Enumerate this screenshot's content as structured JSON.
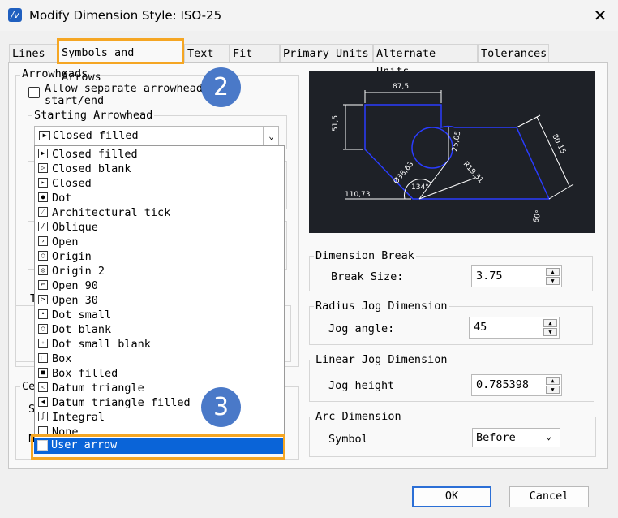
{
  "window": {
    "title": "Modify Dimension Style: ISO-25",
    "close_glyph": "✕"
  },
  "tabs": [
    {
      "label": "Lines"
    },
    {
      "label": "Symbols and Arrows"
    },
    {
      "label": "Text"
    },
    {
      "label": "Fit"
    },
    {
      "label": "Primary Units"
    },
    {
      "label": "Alternate Units"
    },
    {
      "label": "Tolerances"
    }
  ],
  "arrowheads": {
    "group_label": "Arrowheads",
    "allow_separate_line1": "Allow separate arrowhead",
    "allow_separate_line2": "start/end",
    "starting_label": "Starting Arrowhead",
    "selected": "Closed filled",
    "options": [
      {
        "label": "Closed filled",
        "icon": "closed-filled-icon",
        "glyph": "▶"
      },
      {
        "label": "Closed blank",
        "icon": "closed-blank-icon",
        "glyph": "▷"
      },
      {
        "label": "Closed",
        "icon": "closed-icon",
        "glyph": "▸"
      },
      {
        "label": "Dot",
        "icon": "dot-icon",
        "glyph": "●"
      },
      {
        "label": "Architectural tick",
        "icon": "architectural-tick-icon",
        "glyph": "⁄"
      },
      {
        "label": "Oblique",
        "icon": "oblique-icon",
        "glyph": "/"
      },
      {
        "label": "Open",
        "icon": "open-icon",
        "glyph": "›"
      },
      {
        "label": "Origin",
        "icon": "origin-icon",
        "glyph": "○"
      },
      {
        "label": "Origin 2",
        "icon": "origin-2-icon",
        "glyph": "◎"
      },
      {
        "label": "Open 90",
        "icon": "open-90-icon",
        "glyph": "⌐"
      },
      {
        "label": "Open 30",
        "icon": "open-30-icon",
        "glyph": ">"
      },
      {
        "label": "Dot small",
        "icon": "dot-small-icon",
        "glyph": "•"
      },
      {
        "label": "Dot blank",
        "icon": "dot-blank-icon",
        "glyph": "○"
      },
      {
        "label": "Dot small blank",
        "icon": "dot-small-blank-icon",
        "glyph": "◦"
      },
      {
        "label": "Box",
        "icon": "box-icon",
        "glyph": "□"
      },
      {
        "label": "Box filled",
        "icon": "box-filled-icon",
        "glyph": "■"
      },
      {
        "label": "Datum triangle",
        "icon": "datum-triangle-icon",
        "glyph": "◁"
      },
      {
        "label": "Datum triangle filled",
        "icon": "datum-triangle-filled-icon",
        "glyph": "◀"
      },
      {
        "label": "Integral",
        "icon": "integral-icon",
        "glyph": "∫"
      },
      {
        "label": "None",
        "icon": "none-icon",
        "glyph": ""
      },
      {
        "label": "User arrow",
        "icon": "user-arrow-icon",
        "glyph": ""
      }
    ],
    "highlighted": "User arrow"
  },
  "left_partial_labels": {
    "t": "T",
    "ce": "Ce",
    "s": "S",
    "n": "N"
  },
  "preview": {
    "dim_top": "87,5",
    "dim_left": "51,5",
    "dim_right": "80,15",
    "dim_mid": "25,05",
    "dim_diameter": "Ø38,63",
    "dim_radius": "R19,31",
    "dim_angle": "134°",
    "dim_bottom_left": "110,73",
    "dim_bottom_right": "60°"
  },
  "dimension_break": {
    "group_label": "Dimension Break",
    "field_label": "Break Size:",
    "value": "3.75"
  },
  "radius_jog": {
    "group_label": "Radius Jog Dimension",
    "field_label": "Jog angle:",
    "value": "45"
  },
  "linear_jog": {
    "group_label": "Linear Jog Dimension",
    "field_label": "Jog height",
    "value": "0.785398"
  },
  "arc_dimension": {
    "group_label": "Arc Dimension",
    "field_label": "Symbol",
    "value": "Before"
  },
  "footer": {
    "ok": "OK",
    "cancel": "Cancel"
  },
  "badges": {
    "step2": "2",
    "step3": "3"
  },
  "colors": {
    "accent": "#f5a623",
    "badge": "#4a79c8",
    "selection": "#0a64d8",
    "preview_bg": "#1e2127",
    "preview_lines": "#2a3cff"
  }
}
